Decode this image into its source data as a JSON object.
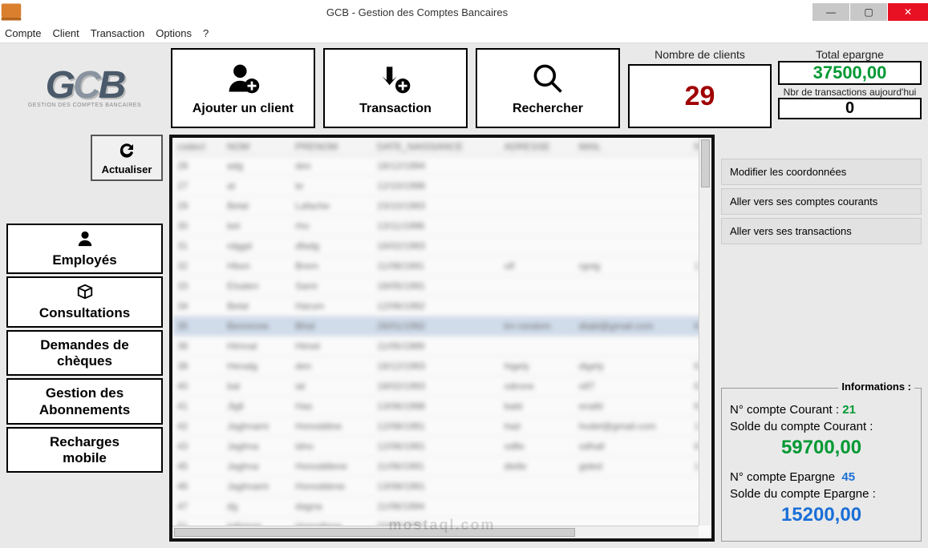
{
  "window": {
    "title": "GCB - Gestion des Comptes Bancaires",
    "min": "—",
    "max": "▢",
    "close": "✕"
  },
  "menu": {
    "compte": "Compte",
    "client": "Client",
    "transaction": "Transaction",
    "options": "Options",
    "help": "?"
  },
  "logo": {
    "brand": "GCB",
    "subtitle": "Gestion des Comptes Bancaires"
  },
  "topbuttons": {
    "add_client": "Ajouter un client",
    "transaction": "Transaction",
    "search": "Rechercher"
  },
  "stats": {
    "clients_label": "Nombre de clients",
    "clients_value": "29",
    "epargne_label": "Total epargne",
    "epargne_value": "37500,00",
    "trans_today_label": "Nbr de transactions aujourd'hui",
    "trans_today_value": "0"
  },
  "refresh": {
    "label": "Actualiser"
  },
  "sidebar": {
    "employees": "Employés",
    "consult": "Consultations",
    "cheques_1": "Demandes de",
    "cheques_2": "chèques",
    "abon_1": "Gestion des",
    "abon_2": "Abonnements",
    "recharge_1": "Recharges",
    "recharge_2": "mobile"
  },
  "grid": {
    "headers": [
      "codecl",
      "NOM",
      "PRENOM",
      "DATE_NAISSANCE",
      "ADRESSE",
      "MAIL",
      "N"
    ],
    "watermark": "mostaql.com"
  },
  "actions": {
    "a1": "Modifier les coordonnées",
    "a2": "Aller vers ses comptes courants",
    "a3": "Aller vers ses transactions"
  },
  "info": {
    "legend": "Informations :",
    "courant_lbl": "N° compte Courant :",
    "courant_num": "21",
    "courant_solde_lbl": "Solde du compte Courant :",
    "courant_solde": "59700,00",
    "epargne_lbl": "N° compte Epargne",
    "epargne_num": "45",
    "epargne_solde_lbl": "Solde du compte Epargne :",
    "epargne_solde": "15200,00"
  }
}
